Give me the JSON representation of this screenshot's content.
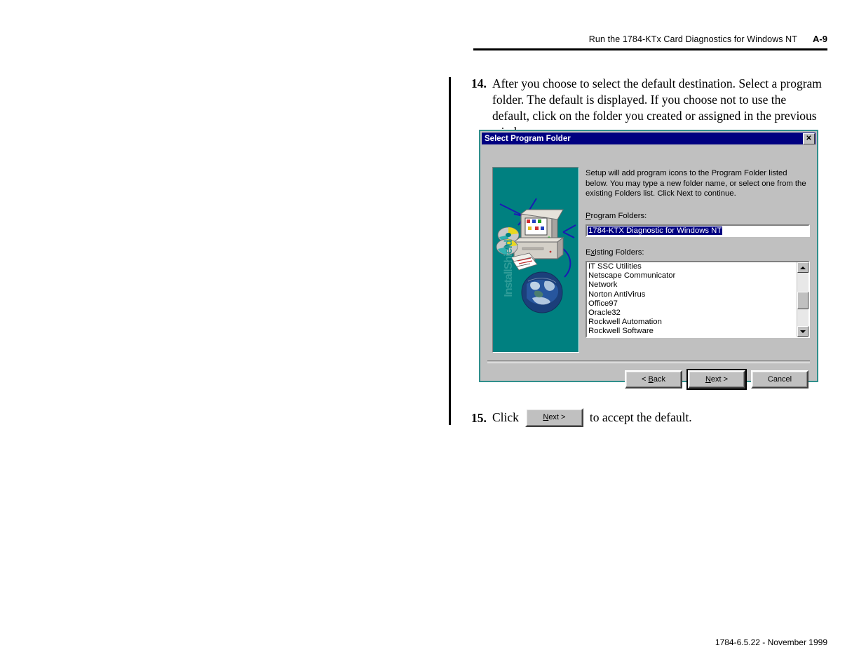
{
  "header": {
    "title": "Run the 1784-KTx Card Diagnostics for Windows NT",
    "page_number": "A-9"
  },
  "steps": [
    {
      "number": "14.",
      "text": "After you choose to select the default destination. Select a program folder. The default is displayed. If you choose not to use the default, click on the folder you created or assigned in the previous window."
    },
    {
      "number": "15.",
      "prefix": "Click",
      "button_label": "Next >",
      "button_accel": "N",
      "suffix": "to accept the default."
    }
  ],
  "dialog": {
    "title": "Select Program Folder",
    "close_label": "✕",
    "watermark": "InstallShield",
    "description": "Setup will add program icons to the Program Folder listed below. You may type a new folder name, or select one from the existing Folders list.  Click Next to continue.",
    "program_folders_label": "Program Folders:",
    "program_folders_accel": "P",
    "program_folders_value": "1784-KTX Diagnostic for Windows NT",
    "existing_folders_label": "Existing Folders:",
    "existing_folders_accel": "x",
    "existing_folders": [
      "IT SSC Utilities",
      "Netscape Communicator",
      "Network",
      "Norton AntiVirus",
      "Office97",
      "Oracle32",
      "Rockwell Automation",
      "Rockwell Software"
    ],
    "buttons": [
      {
        "label": "< Back",
        "accel": "B",
        "default": false
      },
      {
        "label": "Next >",
        "accel": "N",
        "default": true
      },
      {
        "label": "Cancel",
        "accel": "",
        "default": false
      }
    ],
    "colors": {
      "titlebar": "#000080",
      "face": "#c0c0c0",
      "panel_teal": "#008080",
      "border_teal": "#2f8f8c",
      "selection": "#000080"
    }
  },
  "footer": {
    "text": "1784-6.5.22 - November 1999"
  }
}
